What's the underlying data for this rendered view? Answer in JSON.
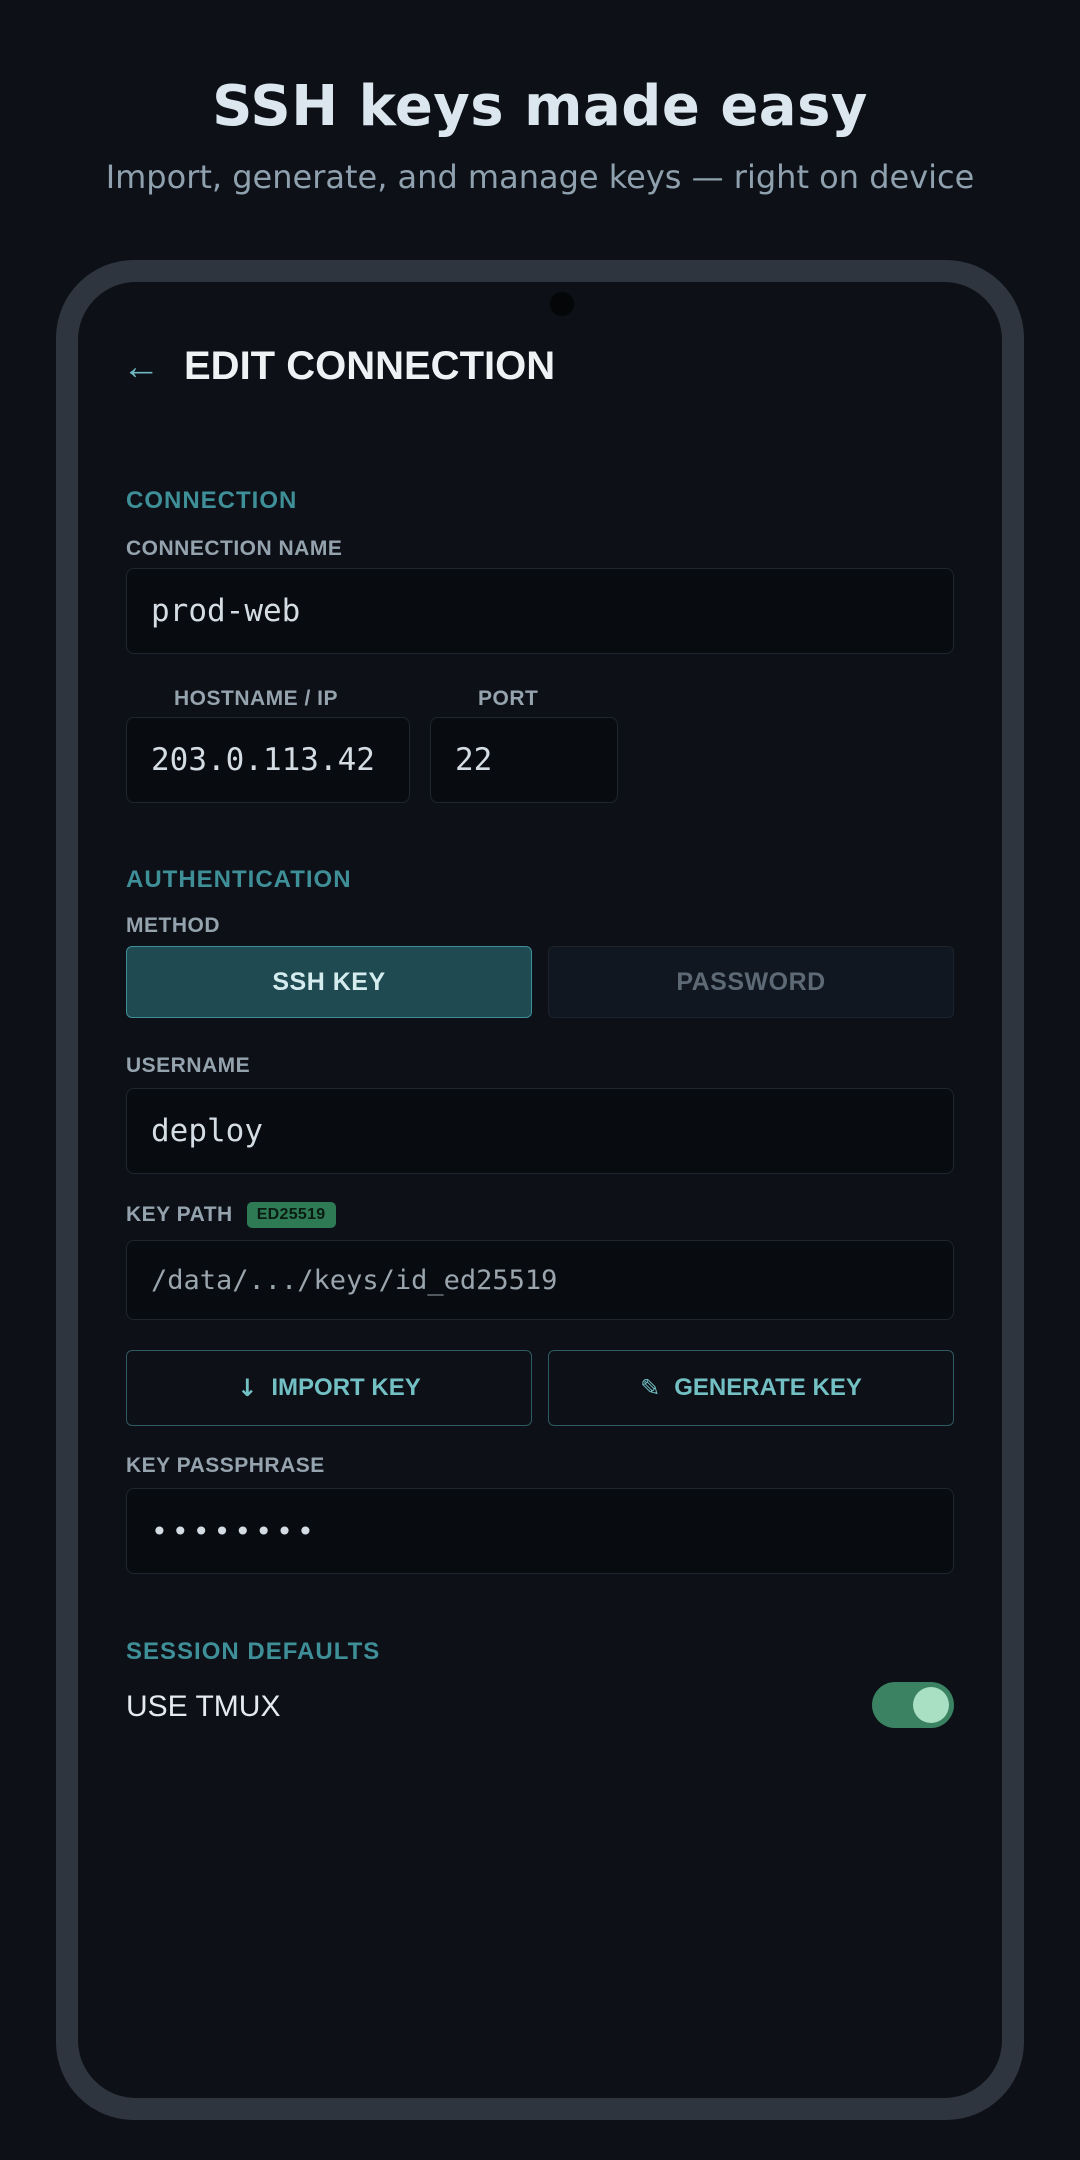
{
  "promo": {
    "title": "SSH keys made easy",
    "subtitle": "Import, generate, and manage keys — right on device"
  },
  "header": {
    "back_icon": "←",
    "title": "EDIT CONNECTION"
  },
  "connection": {
    "section_label": "CONNECTION",
    "name_label": "CONNECTION NAME",
    "name_value": "prod-web",
    "host_label": "HOSTNAME / IP",
    "host_value": "203.0.113.42",
    "port_label": "PORT",
    "port_value": "22"
  },
  "auth": {
    "section_label": "AUTHENTICATION",
    "method_label": "METHOD",
    "method_options": [
      "SSH KEY",
      "PASSWORD"
    ],
    "method_selected": "SSH KEY",
    "username_label": "USERNAME",
    "username_value": "deploy",
    "key_path_label": "KEY PATH",
    "key_type_badge": "ED25519",
    "key_path_value": "/data/.../keys/id_ed25519",
    "import_icon": "↓",
    "import_label": "IMPORT KEY",
    "generate_icon": "✎",
    "generate_label": "GENERATE KEY",
    "passphrase_label": "KEY PASSPHRASE",
    "passphrase_value": "••••••••"
  },
  "session": {
    "section_label": "SESSION DEFAULTS",
    "tmux_label": "USE TMUX",
    "tmux_enabled": true
  },
  "colors": {
    "accent": "#3f8f98",
    "toggle_on": "#3a8261",
    "background": "#0d1117"
  }
}
